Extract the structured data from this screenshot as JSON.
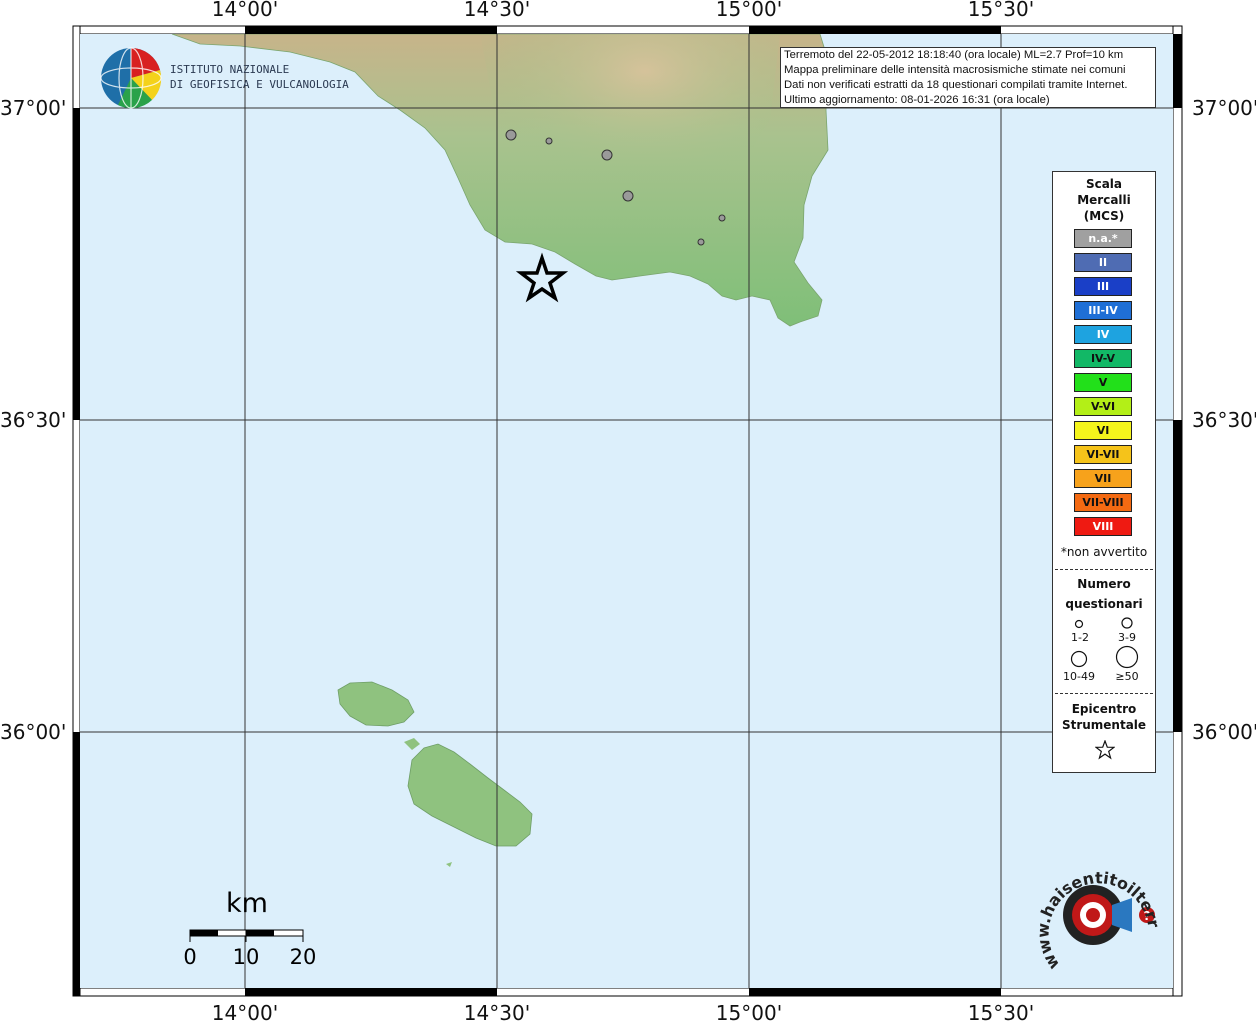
{
  "map": {
    "title_lines": [
      "Terremoto del 22-05-2012 18:18:40 (ora locale) ML=2.7 Prof=10 km",
      "Mappa preliminare delle intensità macrosismiche stimate nei comuni",
      "Dati non verificati estratti da 18 questionari compilati tramite Internet.",
      "Ultimo aggiornamento: 08-01-2026 16:31 (ora locale)"
    ],
    "longitude_labels": [
      "14°00'",
      "14°30'",
      "15°00'",
      "15°30'"
    ],
    "latitude_labels": [
      "37°00'",
      "36°30'",
      "36°00'"
    ],
    "colors": {
      "sea": "#dceffb",
      "land_low": "#86c07a",
      "land_high": "#cdb88d",
      "grid": "#333333"
    }
  },
  "ingv_logo": {
    "line1": "ISTITUTO NAZIONALE",
    "line2": "DI GEOFISICA E VULCANOLOGIA"
  },
  "legend": {
    "title_lines": [
      "Scala",
      "Mercalli",
      "(MCS)"
    ],
    "intensities": [
      {
        "label": "n.a.*",
        "color": "#a0a0a0",
        "text_color": "#ffffff"
      },
      {
        "label": "II",
        "color": "#4f6cb3",
        "text_color": "#ffffff"
      },
      {
        "label": "III",
        "color": "#1a3fc7",
        "text_color": "#ffffff"
      },
      {
        "label": "III-IV",
        "color": "#1f6fd6",
        "text_color": "#ffffff"
      },
      {
        "label": "IV",
        "color": "#1ea3e0",
        "text_color": "#ffffff"
      },
      {
        "label": "IV-V",
        "color": "#12b866",
        "text_color": "#111111"
      },
      {
        "label": "V",
        "color": "#22e01a",
        "text_color": "#111111"
      },
      {
        "label": "V-VI",
        "color": "#b3ef17",
        "text_color": "#111111"
      },
      {
        "label": "VI",
        "color": "#f5f51c",
        "text_color": "#111111"
      },
      {
        "label": "VI-VII",
        "color": "#f5c31a",
        "text_color": "#111111"
      },
      {
        "label": "VII",
        "color": "#f7a21b",
        "text_color": "#111111"
      },
      {
        "label": "VII-VIII",
        "color": "#f46a12",
        "text_color": "#111111"
      },
      {
        "label": "VIII",
        "color": "#ef1a12",
        "text_color": "#ffffff"
      }
    ],
    "not_felt_note": "*non avvertito",
    "questionnaire_title_lines": [
      "Numero",
      "questionari"
    ],
    "questionnaire_bins": [
      "1-2",
      "3-9",
      "10-49",
      "≥50"
    ],
    "epicenter_title_lines": [
      "Epicentro",
      "Strumentale"
    ]
  },
  "scale_bar": {
    "unit": "km",
    "ticks": [
      "0",
      "10",
      "20"
    ]
  },
  "site_logo": {
    "text": "www.haisentitoilterremoto.it"
  }
}
